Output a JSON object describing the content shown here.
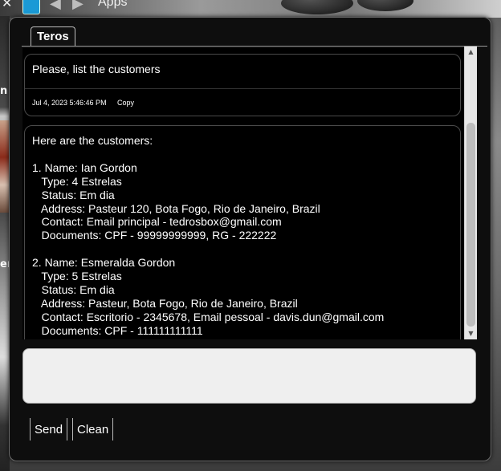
{
  "background": {
    "top_label": "Apps"
  },
  "window": {
    "tab_label": "Teros"
  },
  "messages": [
    {
      "text": "Please, list the customers",
      "timestamp": "Jul 4, 2023 5:46:46 PM",
      "copy_label": "Copy"
    },
    {
      "text": "Here are the customers:\n\n1. Name: Ian Gordon\n   Type: 4 Estrelas\n   Status: Em dia\n   Address: Pasteur 120, Bota Fogo, Rio de Janeiro, Brazil\n   Contact: Email principal - tedrosbox@gmail.com\n   Documents: CPF - 99999999999, RG - 222222\n\n2. Name: Esmeralda Gordon\n   Type: 5 Estrelas\n   Status: Em dia\n   Address: Pasteur, Bota Fogo, Rio de Janeiro, Brazil\n   Contact: Escritorio - 2345678, Email pessoal - davis.dun@gmail.com\n   Documents: CPF - 111111111111"
    }
  ],
  "input": {
    "value": ""
  },
  "buttons": {
    "send_label": "Send",
    "clean_label": "Clean"
  },
  "icons": {
    "scroll_up": "triangle-up",
    "scroll_down": "triangle-down",
    "nav_back": "triangle-left",
    "nav_forward": "triangle-right"
  },
  "colors": {
    "window_bg": "#0e0e0e",
    "message_bg": "#000000",
    "text": "#ffffff",
    "input_bg": "#efefef"
  }
}
